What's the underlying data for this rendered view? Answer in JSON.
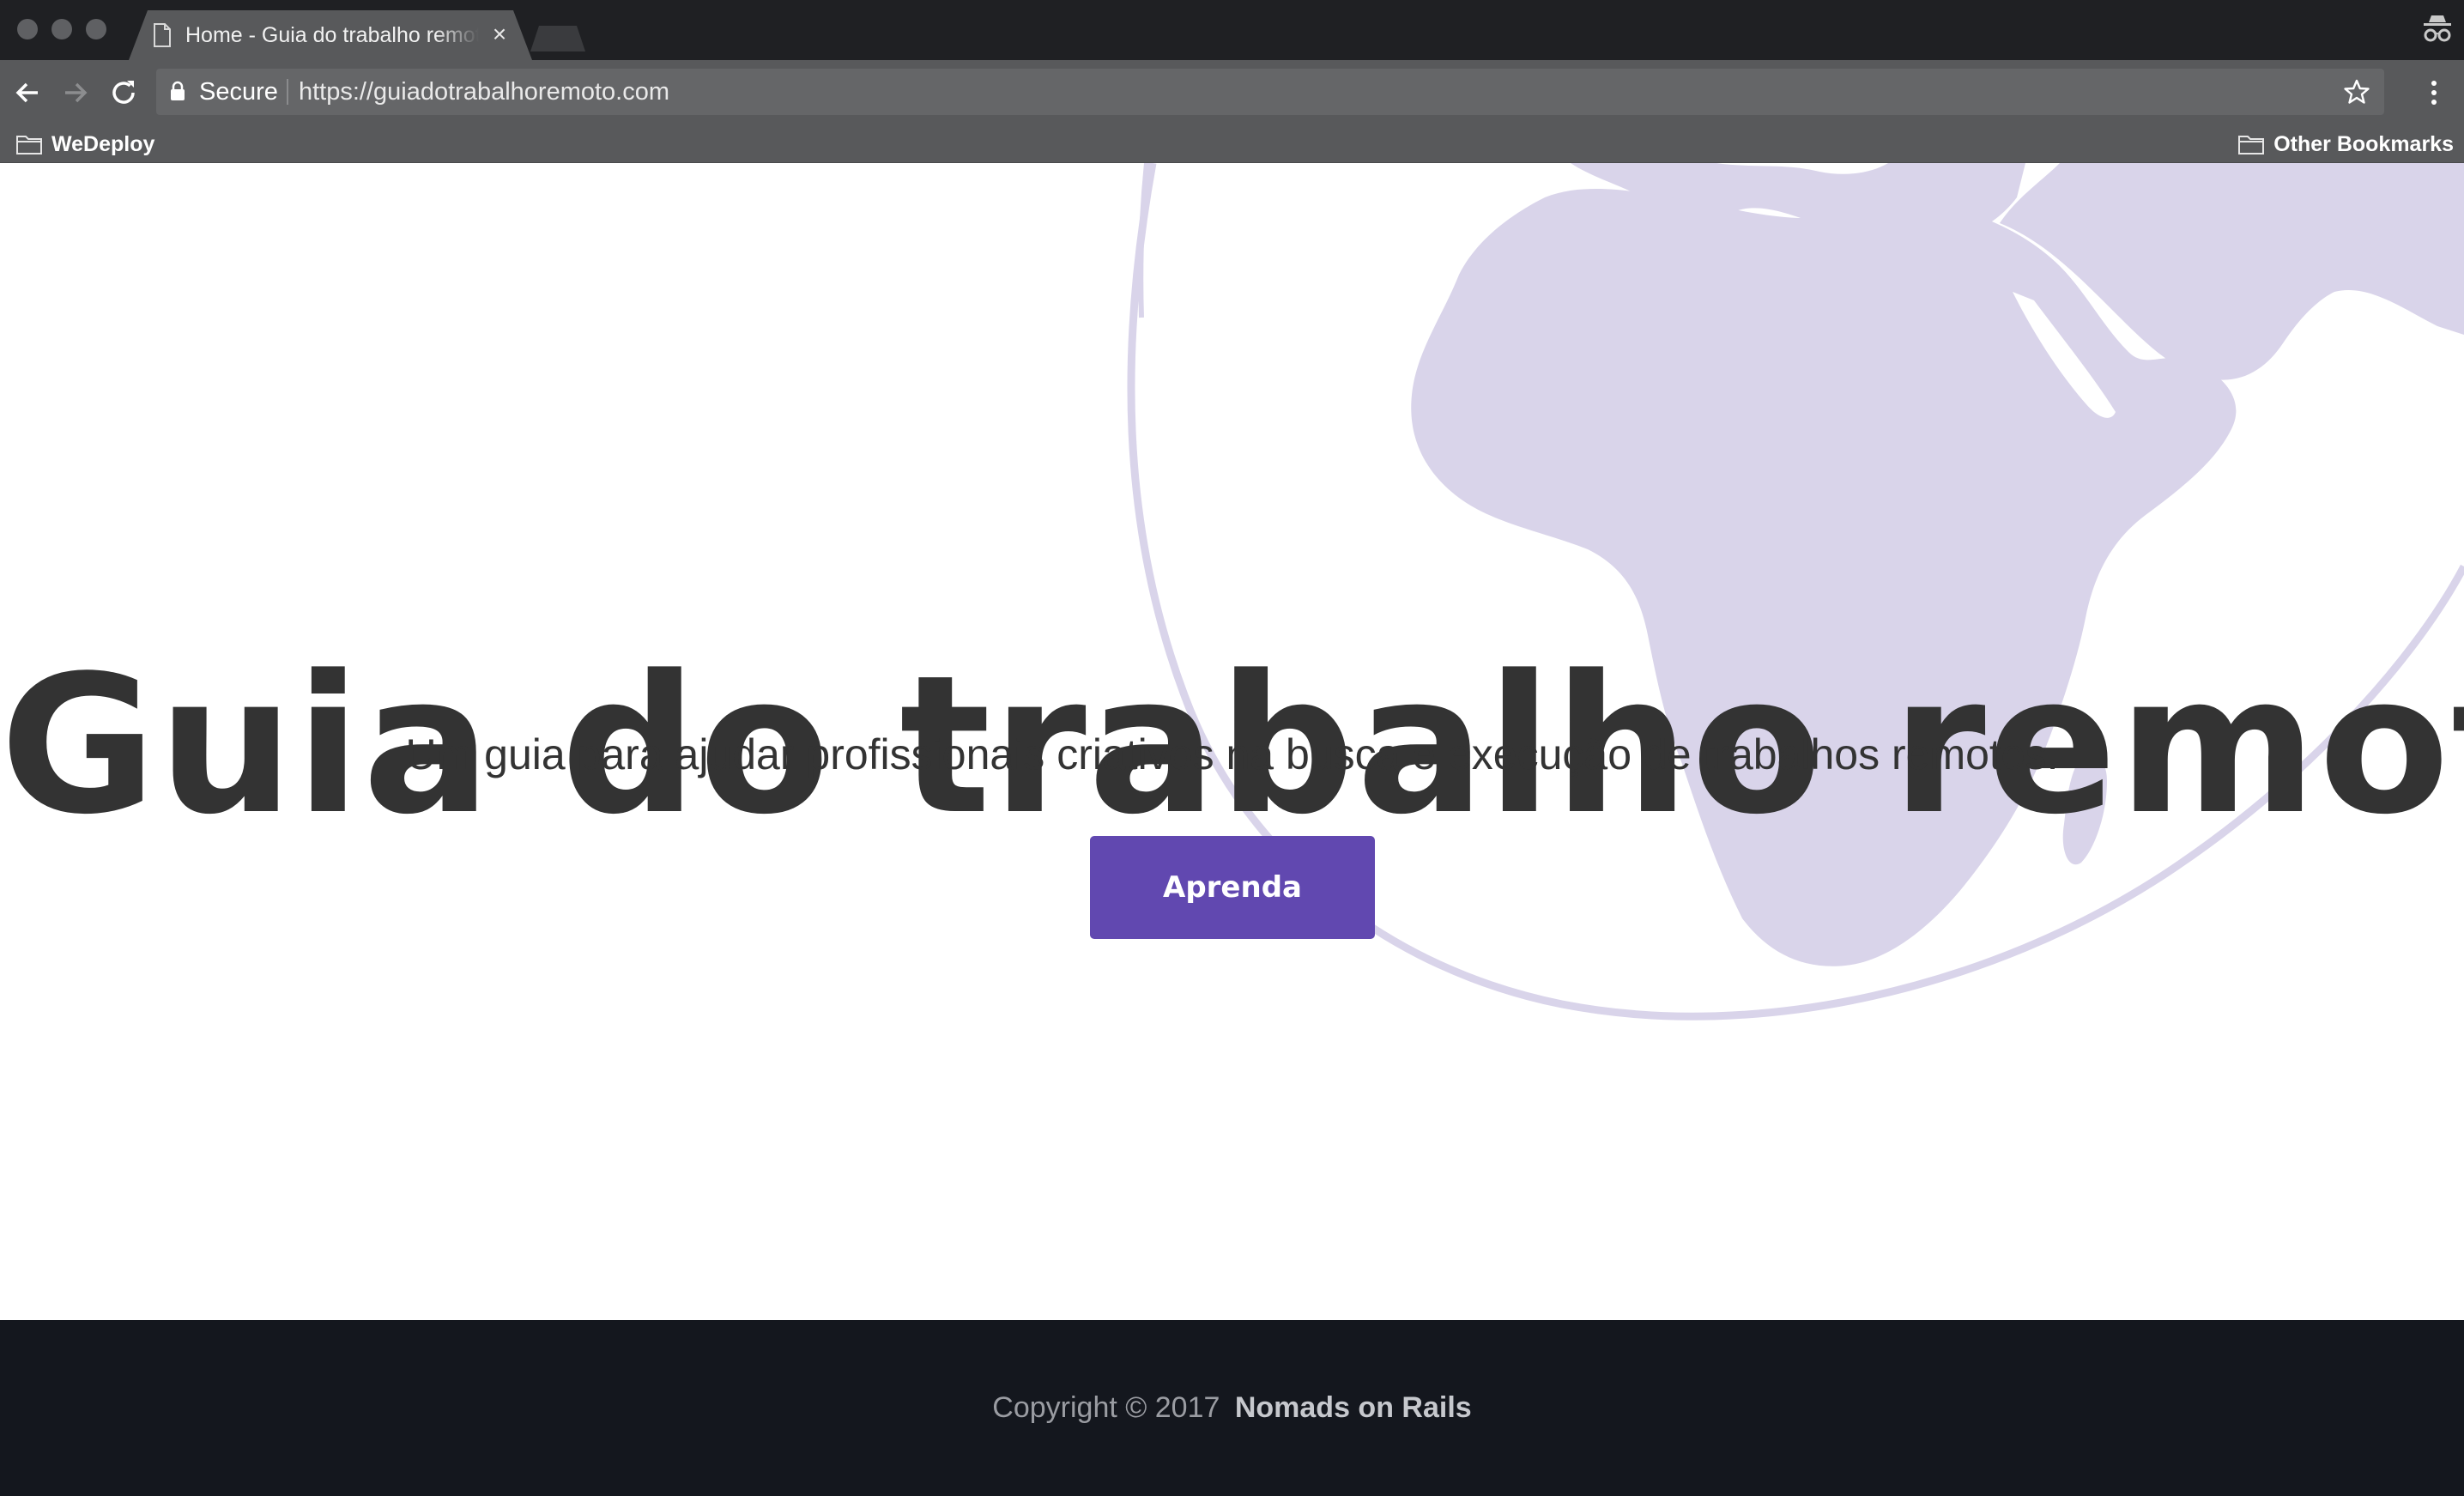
{
  "browser": {
    "tab": {
      "title": "Home - Guia do trabalho remoto",
      "close_glyph": "×",
      "icon": "document-icon"
    },
    "toolbar": {
      "secure_label": "Secure",
      "url": "https://guiadotrabalhoremoto.com"
    },
    "bookmarks": [
      {
        "label": "WeDeploy",
        "icon": "folder-icon"
      },
      {
        "label": "Other Bookmarks",
        "icon": "folder-icon"
      }
    ]
  },
  "hero": {
    "title": "Guia do trabalho remoto",
    "subtitle": "Um guia para ajudar profissionais criativos na busca e execução de trabalhos remotos.",
    "cta_label": "Aprenda"
  },
  "footer": {
    "copyright": "Copyright © 2017",
    "brand": "Nomads on Rails"
  },
  "colors": {
    "accent": "#6148b0",
    "globe": "#d9d4ea",
    "footer_bg": "#14171e",
    "text": "#333333"
  }
}
